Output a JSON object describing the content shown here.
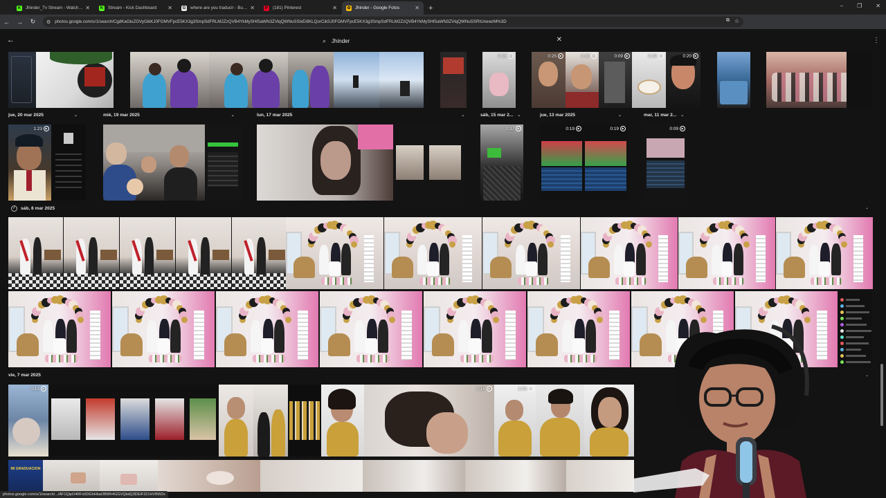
{
  "browser": {
    "tabs": [
      {
        "label": "Jhinder_Tv Stream - Watch Live",
        "fav_color": "#53fc18",
        "fav_char": "K",
        "active": false
      },
      {
        "label": "Stream - Kick Dashboard",
        "fav_color": "#53fc18",
        "fav_char": "K",
        "active": false
      },
      {
        "label": "where are you traducir - Buscar",
        "fav_color": "#e8e8e8",
        "fav_char": "G",
        "active": false
      },
      {
        "label": "(181) Pinterest",
        "fav_color": "#e60023",
        "fav_char": "P",
        "active": false
      },
      {
        "label": "Jhinder - Google Fotos",
        "fav_color": "#fbbc04",
        "fav_char": "✿",
        "active": true
      }
    ],
    "new_tab": "+",
    "window_controls": [
      "–",
      "❐",
      "✕"
    ],
    "url": "photos.google.com/u/1/search/CgdKaGluZGVyGikKJ0FGMVFpcE5KX3g3SmpSdFRLM2ZzQVB4YkMySHlSaWN3ZVlqQWNuSSlxEi8KLQorCikSJ0FGMVFpcE5KX3g3SmpSdFRLM2ZzQVB4YkMySHlSaWN3ZVlqQWNuSSRtUnewzM%3D",
    "status_url": "photos.google.com/u/1/search/.../AF1QipO4RFs5DGhHbaOBWh4GGVQkdQ3DEIF321HVBW2s"
  },
  "gphotos": {
    "search_query": "Jhinder",
    "back_icon": "arrow-back-icon",
    "dates": {
      "d1": "jue, 20 mar 2025",
      "d2": "mié, 19 mar 2025",
      "d3": "lun, 17 mar 2025",
      "d4": "sáb, 15 mar 2...",
      "d5": "jue, 13 mar 2025",
      "d6": "mar, 11 mar 2...",
      "d7": "sáb, 8 mar 2025",
      "d8": "vie, 7 mar 2025"
    },
    "video_durations": {
      "v1": "0:18",
      "v2": "0:25",
      "v3": "0:30",
      "v4": "0:09",
      "v5": "0:19",
      "v6": "0:20",
      "v7": "1:23",
      "v8": "0:37",
      "v9": "0:19",
      "v10": "0:19",
      "v11": "0:09",
      "v12": "0:13",
      "v13": "0:16",
      "v14": "0:13",
      "v15": "0:18",
      "v16": "1:04"
    },
    "graduation_label": "MI GRADUACION"
  },
  "colors": {
    "background": "#131313",
    "chrome_dark": "#1f1f1f",
    "chrome_mid": "#35363a",
    "party_pink": "#e9b3c6",
    "gold": "#c8a046"
  }
}
